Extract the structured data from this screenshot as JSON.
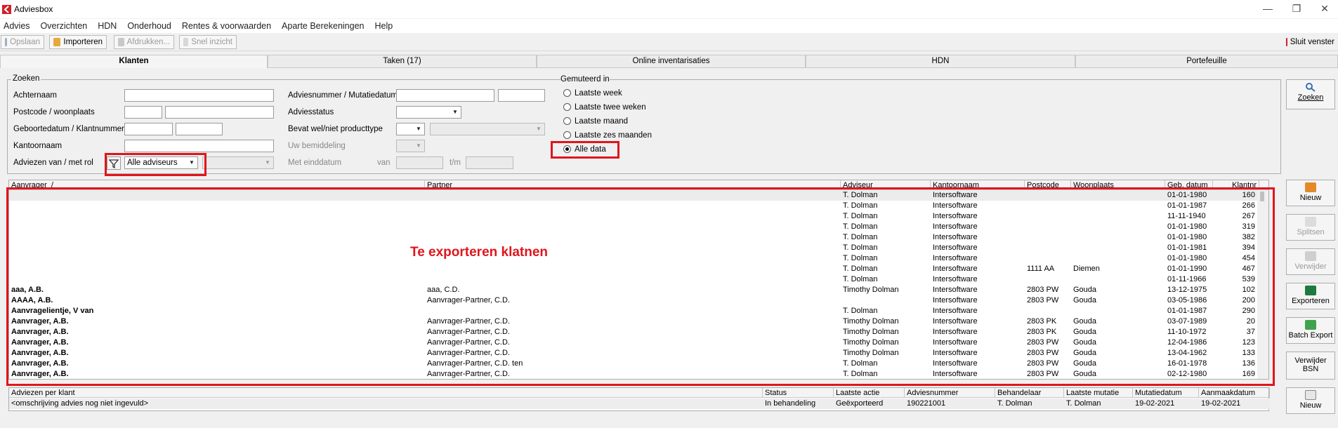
{
  "window": {
    "title": "Adviesbox",
    "minimize": "—",
    "restore": "❐",
    "close": "✕"
  },
  "menu": [
    "Advies",
    "Overzichten",
    "HDN",
    "Onderhoud",
    "Rentes & voorwaarden",
    "Aparte Berekeningen",
    "Help"
  ],
  "toolbar": {
    "save": "Opslaan",
    "import": "Importeren",
    "print": "Afdrukken...",
    "quick": "Snel inzicht",
    "close": "Sluit venster"
  },
  "tabs": [
    "Klanten",
    "Taken (17)",
    "Online inventarisaties",
    "HDN",
    "Portefeuille"
  ],
  "search": {
    "group": "Zoeken",
    "achternaam": "Achternaam",
    "postcode": "Postcode / woonplaats",
    "geboorte": "Geboortedatum / Klantnummer",
    "kantoor": "Kantoornaam",
    "adviezen": "Adviezen van / met rol",
    "adviseur_select": "Alle adviseurs",
    "adviesnummer": "Adviesnummer / Mutatiedatum",
    "status": "Adviesstatus",
    "bevat": "Bevat wel/niet producttype",
    "bemiddeling": "Uw bemiddeling",
    "einddatum": "Met einddatum",
    "van": "van",
    "tm": "t/m"
  },
  "gemuteerd": {
    "group": "Gemuteerd in",
    "options": [
      "Laatste week",
      "Laatste twee weken",
      "Laatste maand",
      "Laatste zes maanden",
      "Alle data"
    ],
    "selected": "Alle data"
  },
  "side": {
    "zoeken": "Zoeken",
    "nieuw": "Nieuw",
    "splitsen": "Splitsen",
    "verwijder": "Verwijder",
    "exporteren": "Exporteren",
    "batch": "Batch Export",
    "verwijder_bsn": "Verwijder BSN",
    "nieuw2": "Nieuw"
  },
  "grid": {
    "headers": [
      "Aanvrager",
      "Partner",
      "Adviseur",
      "Kantoornaam",
      "Postcode",
      "Woonplaats",
      "Geb. datum",
      "Klantnr"
    ],
    "sort_indicator": "/",
    "rows": [
      [
        "",
        "",
        "T. Dolman",
        "Intersoftware",
        "",
        "",
        "01-01-1980",
        "160"
      ],
      [
        "",
        "",
        "T. Dolman",
        "Intersoftware",
        "",
        "",
        "01-01-1987",
        "266"
      ],
      [
        "",
        "",
        "T. Dolman",
        "Intersoftware",
        "",
        "",
        "11-11-1940",
        "267"
      ],
      [
        "",
        "",
        "T. Dolman",
        "Intersoftware",
        "",
        "",
        "01-01-1980",
        "319"
      ],
      [
        "",
        "",
        "T. Dolman",
        "Intersoftware",
        "",
        "",
        "01-01-1980",
        "382"
      ],
      [
        "",
        "",
        "T. Dolman",
        "Intersoftware",
        "",
        "",
        "01-01-1981",
        "394"
      ],
      [
        "",
        "",
        "T. Dolman",
        "Intersoftware",
        "",
        "",
        "01-01-1980",
        "454"
      ],
      [
        "",
        "",
        "T. Dolman",
        "Intersoftware",
        "1111 AA",
        "Diemen",
        "01-01-1990",
        "467"
      ],
      [
        "",
        "",
        "T. Dolman",
        "Intersoftware",
        "",
        "",
        "01-11-1966",
        "539"
      ],
      [
        "aaa, A.B.",
        "aaa, C.D.",
        "Timothy Dolman",
        "Intersoftware",
        "2803 PW",
        "Gouda",
        "13-12-1975",
        "102"
      ],
      [
        "AAAA, A.B.",
        "Aanvrager-Partner, C.D.",
        "",
        "Intersoftware",
        "2803 PW",
        "Gouda",
        "03-05-1986",
        "200"
      ],
      [
        "Aanvragelientje, V van",
        "",
        "T. Dolman",
        "Intersoftware",
        "",
        "",
        "01-01-1987",
        "290"
      ],
      [
        "Aanvrager, A.B.",
        "Aanvrager-Partner, C.D.",
        "Timothy Dolman",
        "Intersoftware",
        "2803 PK",
        "Gouda",
        "03-07-1989",
        "20"
      ],
      [
        "Aanvrager, A.B.",
        "Aanvrager-Partner, C.D.",
        "Timothy Dolman",
        "Intersoftware",
        "2803 PK",
        "Gouda",
        "11-10-1972",
        "37"
      ],
      [
        "Aanvrager, A.B.",
        "Aanvrager-Partner, C.D.",
        "Timothy Dolman",
        "Intersoftware",
        "2803 PW",
        "Gouda",
        "12-04-1986",
        "123"
      ],
      [
        "Aanvrager, A.B.",
        "Aanvrager-Partner, C.D.",
        "Timothy Dolman",
        "Intersoftware",
        "2803 PW",
        "Gouda",
        "13-04-1962",
        "133"
      ],
      [
        "Aanvrager, A.B.",
        "Aanvrager-Partner, C.D. ten",
        "T. Dolman",
        "Intersoftware",
        "2803 PW",
        "Gouda",
        "16-01-1978",
        "136"
      ],
      [
        "Aanvrager, A.B.",
        "Aanvrager-Partner, C.D.",
        "T. Dolman",
        "Intersoftware",
        "2803 PW",
        "Gouda",
        "02-12-1980",
        "169"
      ]
    ]
  },
  "annotation": "Te exporteren klatnen",
  "detail": {
    "headers": [
      "Adviezen per klant",
      "Status",
      "Laatste actie",
      "Adviesnummer",
      "Behandelaar",
      "Laatste mutatie",
      "Mutatiedatum",
      "Aanmaakdatum"
    ],
    "row": [
      "<omschrijving advies nog niet ingevuld>",
      "In behandeling",
      "Geëxporteerd",
      "190221001",
      "T. Dolman",
      "T. Dolman",
      "19-02-2021",
      "19-02-2021"
    ]
  },
  "colors": {
    "highlight": "#e0151c",
    "annotation": "#e0151c"
  }
}
